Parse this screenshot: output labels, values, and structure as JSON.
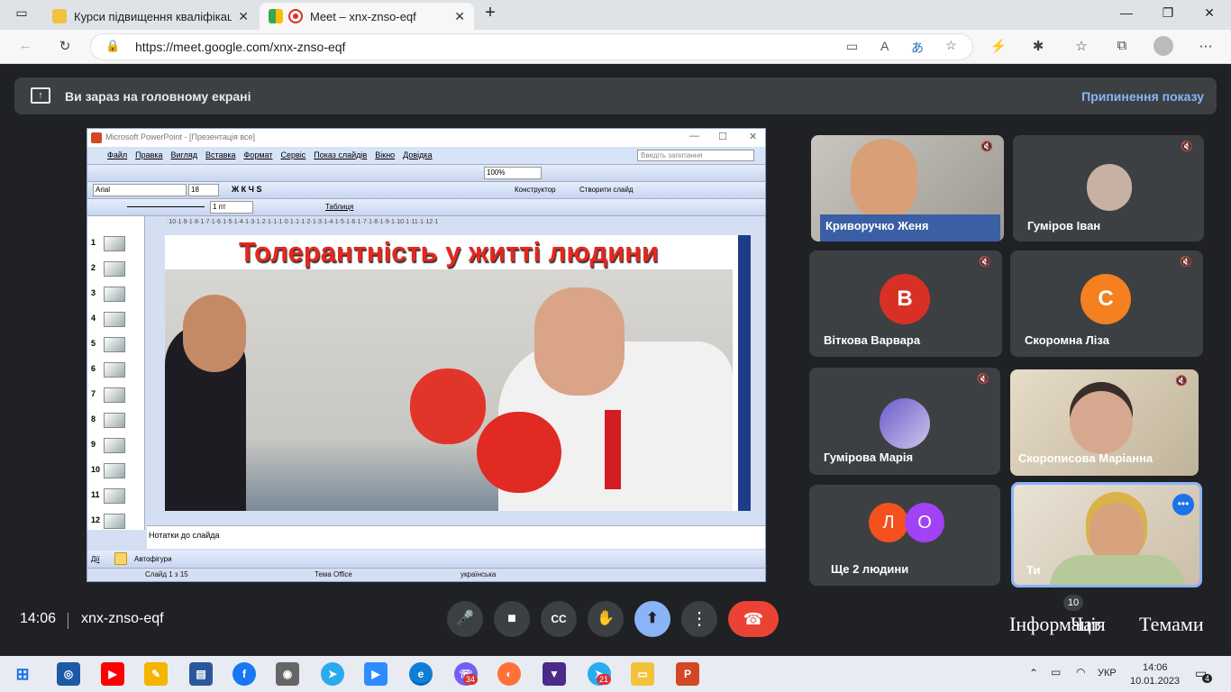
{
  "browser": {
    "tab1": {
      "title": "Курси підвищення кваліфікації"
    },
    "tab2": {
      "title": "Meet – xnx-znso-eqf"
    },
    "url": "https://meet.google.com/xnx-znso-eqf"
  },
  "banner": {
    "text": "Ви зараз на головному екрані",
    "stop_label": "Припинення показу"
  },
  "ppt": {
    "title": "Microsoft PowerPoint - [Презентація все]",
    "menu": [
      "Файл",
      "Правка",
      "Вигляд",
      "Вставка",
      "Формат",
      "Сервіс",
      "Показ слайдів",
      "Вікно",
      "Довідка"
    ],
    "help_placeholder": "Введіть запитання",
    "zoom": "100%",
    "font": "Arial",
    "font_size": "18",
    "designer": "Конструктор",
    "new_slide": "Створити слайд",
    "line_width": "1 пт",
    "table": "Таблиця",
    "ruler": "·10·1·9·1·8·1·7·1·6·1·5·1·4·1·3·1·2·1·1·1·0·1·1·1·2·1·3·1·4·1·5·1·6·1·7·1·8·1·9·1·10·1·11·1·12·1",
    "slide_numbers": [
      "1",
      "2",
      "3",
      "4",
      "5",
      "6",
      "7",
      "8",
      "9",
      "10",
      "11",
      "12"
    ],
    "slide_title": "Толерантність у житті людини",
    "notes": "Нотатки до слайда",
    "draw": "Дії",
    "autoshapes": "Автофігури",
    "status": {
      "slide": "Слайд 1 з 15",
      "theme": "Тема Office",
      "lang": "українська"
    }
  },
  "participants": [
    {
      "name": "Криворучко Женя"
    },
    {
      "name": "Гуміров Іван"
    },
    {
      "name": "Віткова Варвара",
      "initial": "В",
      "color": "#d93025"
    },
    {
      "name": "Скоромна Ліза",
      "initial": "С",
      "color": "#f4801f"
    },
    {
      "name": "Гумірова Марія"
    },
    {
      "name": "Скорописова Маріанна"
    },
    {
      "name": "Ще 2 людини",
      "initials": [
        "Л",
        "О"
      ]
    },
    {
      "name": "Ти"
    }
  ],
  "meeting": {
    "time": "14:06",
    "code": "xnx-znso-eqf",
    "people_count": "10",
    "info_label": "Інформація",
    "chat_label": "Чат",
    "themes_label": "Темами"
  },
  "taskbar": {
    "lang": "УКР",
    "time": "14:06",
    "date": "10.01.2023",
    "viber_badge": "34",
    "telegram_badge": "21",
    "notif": "4"
  }
}
